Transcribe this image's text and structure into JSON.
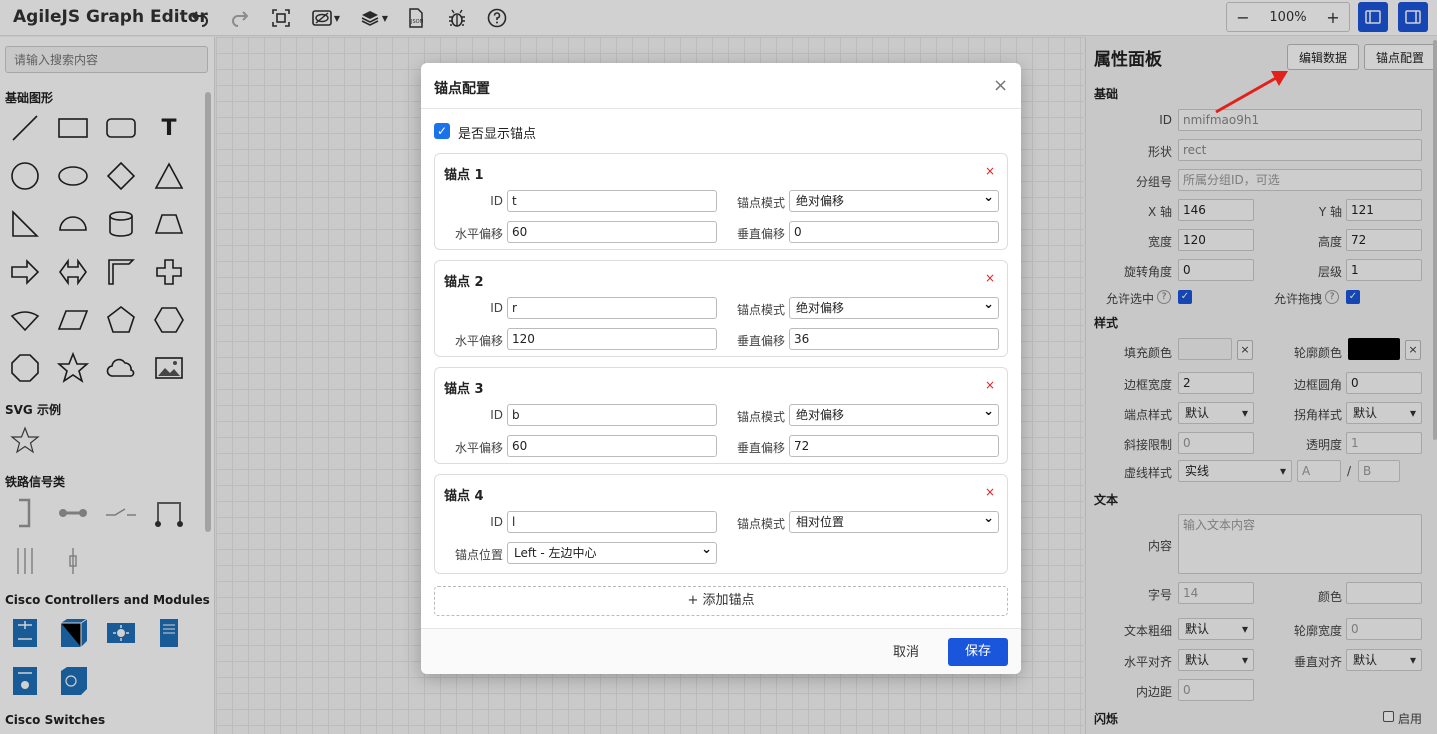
{
  "app": {
    "title": "AgileJS Graph Editor"
  },
  "toolbar": {
    "zoom_minus": "−",
    "zoom_level": "100%",
    "zoom_plus": "+"
  },
  "sidebar": {
    "search_placeholder": "请输入搜索内容",
    "sections": {
      "basic": "基础图形",
      "svg": "SVG 示例",
      "railway": "铁路信号类",
      "cisco_controllers": "Cisco Controllers and Modules",
      "cisco_switches": "Cisco Switches"
    },
    "text_shape_glyph": "T"
  },
  "right_panel": {
    "title": "属性面板",
    "edit_data_btn": "编辑数据",
    "anchor_config_btn": "锚点配置",
    "sections": {
      "basic": "基础",
      "style": "样式",
      "text": "文本",
      "blink": "闪烁"
    },
    "labels": {
      "id": "ID",
      "shape": "形状",
      "group": "分组号",
      "x": "X 轴",
      "y": "Y 轴",
      "width": "宽度",
      "height": "高度",
      "rotation": "旋转角度",
      "layer": "层级",
      "allow_select": "允许选中",
      "allow_drag": "允许拖拽",
      "fill": "填充颜色",
      "stroke": "轮廓颜色",
      "border_width": "边框宽度",
      "border_radius": "边框圆角",
      "cap": "端点样式",
      "join": "拐角样式",
      "miter": "斜接限制",
      "opacity": "透明度",
      "dash": "虚线样式",
      "content": "内容",
      "font_size": "字号",
      "color": "颜色",
      "font_weight": "文本粗细",
      "text_stroke": "轮廓宽度",
      "h_align": "水平对齐",
      "v_align": "垂直对齐",
      "padding": "内边距",
      "enable": "启用"
    },
    "values": {
      "id": "nmifmao9h1",
      "shape": "rect",
      "group_placeholder": "所属分组ID，可选",
      "x": "146",
      "y": "121",
      "width": "120",
      "height": "72",
      "rotation": "0",
      "layer": "1",
      "border_width": "2",
      "border_radius": "0",
      "cap": "默认",
      "join": "默认",
      "miter": "0",
      "opacity": "1",
      "dash": "实线",
      "dash_a": "A",
      "dash_b": "B",
      "dash_sep": "/",
      "content_placeholder": "输入文本内容",
      "font_size": "14",
      "font_weight": "默认",
      "text_stroke": "0",
      "h_align": "默认",
      "v_align": "默认",
      "padding": "0",
      "stroke_color": "#000000",
      "clear": "×",
      "q": "?"
    }
  },
  "modal": {
    "title": "锚点配置",
    "close": "×",
    "show_anchor_label": "是否显示锚点",
    "labels": {
      "id": "ID",
      "mode": "锚点模式",
      "h_offset": "水平偏移",
      "v_offset": "垂直偏移",
      "position": "锚点位置"
    },
    "delete": "×",
    "anchors": [
      {
        "title": "锚点 1",
        "id": "t",
        "mode": "绝对偏移",
        "h": "60",
        "v": "0"
      },
      {
        "title": "锚点 2",
        "id": "r",
        "mode": "绝对偏移",
        "h": "120",
        "v": "36"
      },
      {
        "title": "锚点 3",
        "id": "b",
        "mode": "绝对偏移",
        "h": "60",
        "v": "72"
      },
      {
        "title": "锚点 4",
        "id": "l",
        "mode": "相对位置",
        "position": "Left - 左边中心"
      }
    ],
    "add_anchor": "+ 添加锚点",
    "cancel": "取消",
    "save": "保存"
  },
  "colors": {
    "accent": "#1a56db",
    "arrow": "#e3201b",
    "delete": "#dd2222"
  }
}
